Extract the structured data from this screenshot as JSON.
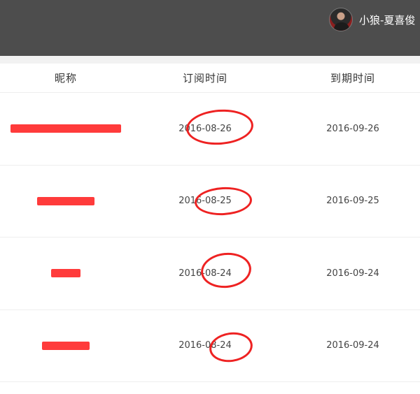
{
  "user": {
    "name": "小狼-夏喜俊",
    "avatar_icon": "avatar-photo"
  },
  "table": {
    "headers": [
      "昵称",
      "订阅时间",
      "到期时间"
    ],
    "rows": [
      {
        "nickname": "",
        "subscribed": "2016-08-26",
        "expires": "2016-09-26"
      },
      {
        "nickname": "",
        "subscribed": "2016-08-25",
        "expires": "2016-09-25"
      },
      {
        "nickname": "",
        "subscribed": "2016-08-24",
        "expires": "2016-09-24"
      },
      {
        "nickname": "",
        "subscribed": "2016-08-24",
        "expires": "2016-09-24"
      }
    ]
  },
  "colors": {
    "topbar": "#4d4d4d",
    "annotation": "#ee2222",
    "redaction": "#ff3b3b"
  }
}
